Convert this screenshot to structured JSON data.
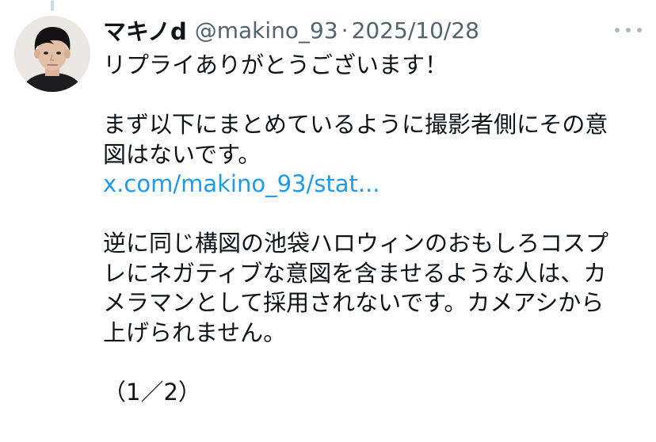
{
  "tweet": {
    "display_name": "マキノd",
    "handle": "@makino_93",
    "separator": "·",
    "date": "2025/10/28",
    "paragraphs": {
      "p1": "リプライありがとうございます！",
      "p2_line1": "まず以下にまとめているように撮影者側にその意",
      "p2_line2": "図はないです。",
      "link_text": "x.com/makino_93/stat...",
      "p3_line1": "逆に同じ構図の池袋ハロウィンのおもしろコスプ",
      "p3_line2": "レにネガティブな意図を含ませるような人は、カ",
      "p3_line3": "メラマンとして採用されないです。カメアシから",
      "p3_line4": "上げられません。",
      "p4": "（1／2）"
    }
  },
  "colors": {
    "name": "#0f1419",
    "meta": "#536471",
    "link": "#1d9bf0",
    "thread_line": "#cfd9de"
  },
  "icons": {
    "more": "more-horizontal-icon"
  }
}
